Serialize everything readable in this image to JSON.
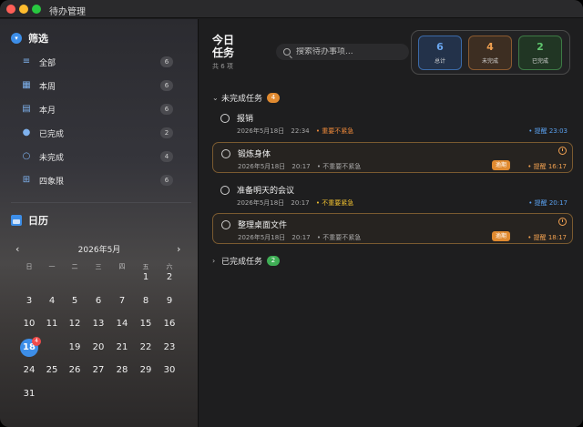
{
  "window": {
    "title": "待办管理"
  },
  "sidebar": {
    "filter_title": "筛选",
    "filters": [
      {
        "label": "全部",
        "count": "6",
        "icon": "list-icon"
      },
      {
        "label": "本周",
        "count": "6",
        "icon": "calendar-week-icon"
      },
      {
        "label": "本月",
        "count": "6",
        "icon": "calendar-month-icon"
      },
      {
        "label": "已完成",
        "count": "2",
        "icon": "check-circle-icon"
      },
      {
        "label": "未完成",
        "count": "4",
        "icon": "circle-icon"
      },
      {
        "label": "四象限",
        "count": "6",
        "icon": "grid-icon"
      }
    ],
    "calendar_title": "日历",
    "calendar": {
      "month_label": "2026年5月",
      "weekdays": [
        "日",
        "一",
        "二",
        "三",
        "四",
        "五",
        "六"
      ],
      "rows": [
        [
          "",
          "",
          "",
          "",
          "",
          "1",
          "2"
        ],
        [
          "3",
          "4",
          "5",
          "6",
          "7",
          "8",
          "9"
        ],
        [
          "10",
          "11",
          "12",
          "13",
          "14",
          "15",
          "16"
        ],
        [
          "17",
          "18",
          "19",
          "20",
          "21",
          "22",
          "23"
        ],
        [
          "24",
          "25",
          "26",
          "27",
          "28",
          "29",
          "30"
        ],
        [
          "31",
          "",
          "",
          "",
          "",
          "",
          ""
        ]
      ],
      "today": "18",
      "today_badge": "4",
      "prev": "‹",
      "next": "›"
    }
  },
  "main": {
    "title": "今日任务",
    "subtitle": "共 6 项",
    "search_placeholder": "搜索待办事项...",
    "stats": [
      {
        "value": "6",
        "label": "总计"
      },
      {
        "value": "4",
        "label": "未完成"
      },
      {
        "value": "2",
        "label": "已完成"
      }
    ],
    "groups": {
      "pending": {
        "label": "未完成任务",
        "count": "4"
      },
      "done": {
        "label": "已完成任务",
        "count": "2"
      }
    },
    "tasks": [
      {
        "title": "报销",
        "date": "2026年5月18日",
        "time": "22:34",
        "priority": "• 重要不紧急",
        "remind": "• 提醒 23:03",
        "overdue": ""
      },
      {
        "title": "锻炼身体",
        "date": "2026年5月18日",
        "time": "20:17",
        "priority": "• 不重要不紧急",
        "remind": "• 提醒 16:17",
        "overdue": "逾期"
      },
      {
        "title": "准备明天的会议",
        "date": "2026年5月18日",
        "time": "20:17",
        "priority": "• 不重要紧急",
        "remind": "• 提醒 20:17",
        "overdue": ""
      },
      {
        "title": "整理桌面文件",
        "date": "2026年5月18日",
        "time": "20:17",
        "priority": "• 不重要不紧急",
        "remind": "• 提醒 18:17",
        "overdue": "逾期"
      }
    ]
  },
  "colors": {
    "accent": "#3d8ee8",
    "pending": "#f0a050",
    "done": "#5fc66e",
    "overdue": "#e08a30"
  }
}
